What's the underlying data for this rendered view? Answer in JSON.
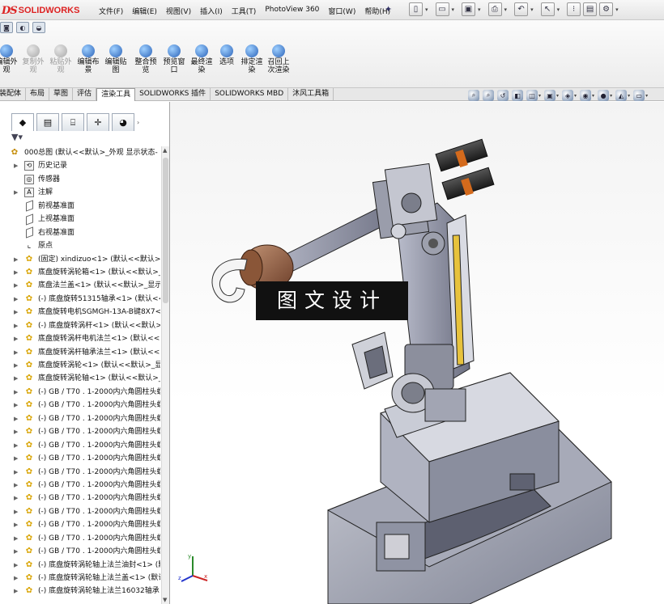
{
  "app": {
    "brand_mark": "DS",
    "brand_name": "SOLIDWORKS"
  },
  "menu": [
    "文件(F)",
    "编辑(E)",
    "视图(V)",
    "插入(I)",
    "工具(T)",
    "PhotoView 360",
    "窗口(W)",
    "帮助(H)"
  ],
  "toolbar_tools": [
    {
      "label": "编辑外观",
      "enabled": true
    },
    {
      "label": "复制外观",
      "enabled": false
    },
    {
      "label": "粘贴外观",
      "enabled": false
    },
    {
      "label": "编辑布景",
      "enabled": true
    },
    {
      "label": "编辑贴图",
      "enabled": true
    },
    {
      "label": "整合预览",
      "enabled": true
    },
    {
      "label": "预览窗口",
      "enabled": true
    },
    {
      "label": "最终渲染",
      "enabled": true
    },
    {
      "label": "选项",
      "enabled": true
    },
    {
      "label": "排定渲染",
      "enabled": true
    },
    {
      "label": "召回上次渲染",
      "enabled": true
    }
  ],
  "tabs": [
    "装配体",
    "布局",
    "草图",
    "评估",
    "渲染工具",
    "SOLIDWORKS 插件",
    "SOLIDWORKS MBD",
    "沐风工具箱"
  ],
  "active_tab": "渲染工具",
  "tree": {
    "root": "000总图 (默认<<默认>_外观 显示状态-",
    "items": [
      {
        "label": "历史记录",
        "icon": "history-folder-icon"
      },
      {
        "label": "传感器",
        "icon": "sensor-icon"
      },
      {
        "label": "注解",
        "icon": "annotation-icon"
      },
      {
        "label": "前视基准面",
        "icon": "plane-icon"
      },
      {
        "label": "上视基准面",
        "icon": "plane-icon"
      },
      {
        "label": "右视基准面",
        "icon": "plane-icon"
      },
      {
        "label": "原点",
        "icon": "origin-icon"
      },
      {
        "label": "(固定) xindizuo<1> (默认<<默认>_",
        "icon": "part-icon"
      },
      {
        "label": "底盘旋转涡轮箱<1> (默认<<默认>_",
        "icon": "part-icon"
      },
      {
        "label": "底盘法兰盖<1> (默认<<默认>_显示",
        "icon": "part-icon"
      },
      {
        "label": "(-) 底盘旋转51315轴承<1> (默认<<",
        "icon": "part-icon"
      },
      {
        "label": "底盘旋转电机SGMGH-13A-B键8X7<",
        "icon": "part-icon"
      },
      {
        "label": "(-) 底盘旋转涡杆<1> (默认<<默认>_",
        "icon": "part-icon"
      },
      {
        "label": "底盘旋转涡杆电机法兰<1> (默认<<",
        "icon": "part-icon"
      },
      {
        "label": "底盘旋转涡杆轴承法兰<1> (默认<<",
        "icon": "part-icon"
      },
      {
        "label": "底盘旋转涡轮<1> (默认<<默认>_显",
        "icon": "part-icon"
      },
      {
        "label": "底盘旋转涡轮轴<1> (默认<<默认>_",
        "icon": "part-icon"
      },
      {
        "label": "(-) GB / T70 . 1-2000内六角圆柱头螺",
        "icon": "part-icon"
      },
      {
        "label": "(-) GB / T70 . 1-2000内六角圆柱头螺",
        "icon": "part-icon"
      },
      {
        "label": "(-) GB / T70 . 1-2000内六角圆柱头螺",
        "icon": "part-icon"
      },
      {
        "label": "(-) GB / T70 . 1-2000内六角圆柱头螺",
        "icon": "part-icon"
      },
      {
        "label": "(-) GB / T70 . 1-2000内六角圆柱头螺",
        "icon": "part-icon"
      },
      {
        "label": "(-) GB / T70 . 1-2000内六角圆柱头螺",
        "icon": "part-icon"
      },
      {
        "label": "(-) GB / T70 . 1-2000内六角圆柱头螺",
        "icon": "part-icon"
      },
      {
        "label": "(-) GB / T70 . 1-2000内六角圆柱头螺",
        "icon": "part-icon"
      },
      {
        "label": "(-) GB / T70 . 1-2000内六角圆柱头螺",
        "icon": "part-icon"
      },
      {
        "label": "(-) GB / T70 . 1-2000内六角圆柱头螺",
        "icon": "part-icon"
      },
      {
        "label": "(-) GB / T70 . 1-2000内六角圆柱头螺",
        "icon": "part-icon"
      },
      {
        "label": "(-) GB / T70 . 1-2000内六角圆柱头螺",
        "icon": "part-icon"
      },
      {
        "label": "(-) GB / T70 . 1-2000内六角圆柱头螺",
        "icon": "part-icon"
      },
      {
        "label": "(-) 底盘旋转涡轮轴上法兰油封<1> (默",
        "icon": "part-icon"
      },
      {
        "label": "(-) 底盘旋转涡轮轴上法兰盖<1> (默认",
        "icon": "part-icon"
      },
      {
        "label": "(-) 底盘旋转涡轮轴上法兰16032轴承",
        "icon": "part-icon"
      }
    ]
  },
  "watermark": "图文设计",
  "triad_labels": {
    "x": "x",
    "y": "y",
    "z": "z"
  }
}
